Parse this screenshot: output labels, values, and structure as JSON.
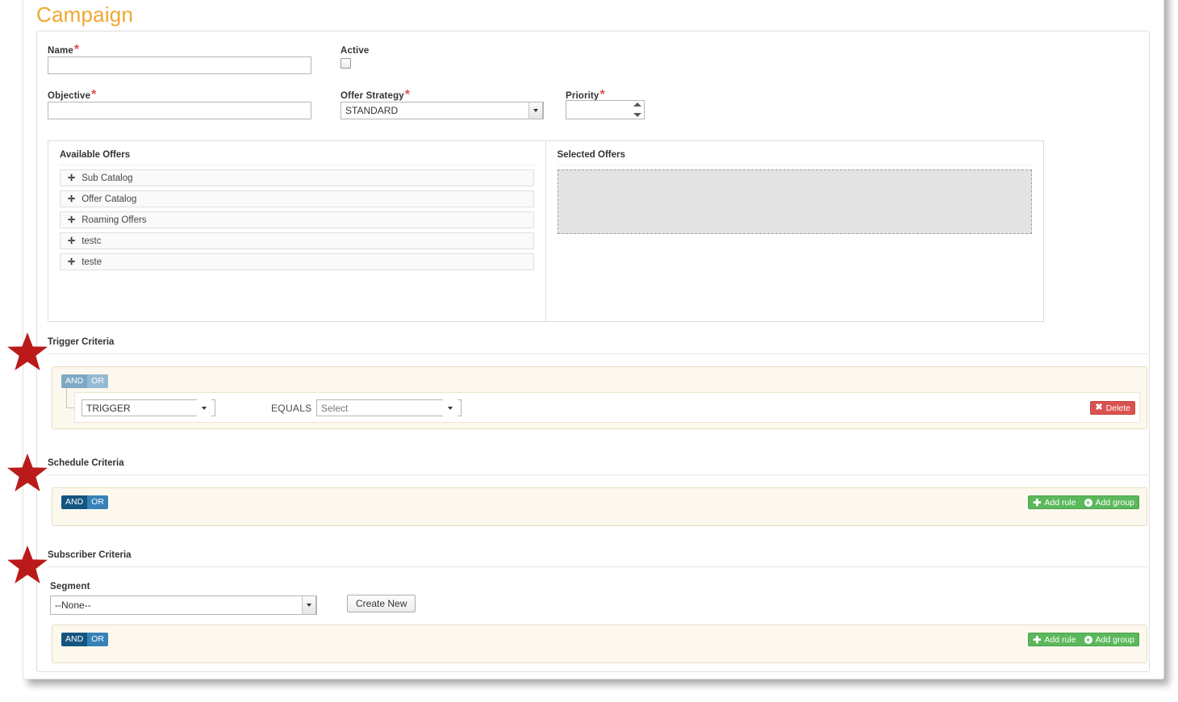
{
  "page": {
    "title": "Campaign"
  },
  "form": {
    "name": {
      "label": "Name",
      "required": "*",
      "value": "",
      "placeholder": ""
    },
    "active": {
      "label": "Active",
      "checked": false
    },
    "objective": {
      "label": "Objective",
      "required": "*",
      "value": "",
      "placeholder": ""
    },
    "offer_strategy": {
      "label": "Offer Strategy",
      "required": "*",
      "value": "STANDARD",
      "options": [
        "STANDARD"
      ]
    },
    "priority": {
      "label": "Priority",
      "required": "*",
      "value": ""
    }
  },
  "offers": {
    "available": {
      "title": "Available Offers",
      "items": [
        {
          "label": "Sub Catalog",
          "icon": "plus-icon"
        },
        {
          "label": "Offer Catalog",
          "icon": "plus-icon"
        },
        {
          "label": "Roaming Offers",
          "icon": "plus-icon"
        },
        {
          "label": "testc",
          "icon": "plus-icon"
        },
        {
          "label": "teste",
          "icon": "plus-icon"
        }
      ]
    },
    "selected": {
      "title": "Selected Offers",
      "items": [],
      "dropzone_text": ""
    }
  },
  "trigger_criteria": {
    "title": "Trigger Criteria",
    "andor": {
      "and": "AND",
      "or": "OR",
      "active": "AND"
    },
    "rule": {
      "field": "TRIGGER",
      "operator": "EQUALS",
      "value": "Select",
      "delete_label": "Delete",
      "delete_icon": "close-x-icon"
    }
  },
  "schedule_criteria": {
    "title": "Schedule Criteria",
    "andor": {
      "and": "AND",
      "or": "OR",
      "active": "AND"
    },
    "add_rule_label": "Add rule",
    "add_group_label": "Add group",
    "add_rule_icon": "plus-icon",
    "add_group_icon": "plus-circle-icon"
  },
  "subscriber_criteria": {
    "title": "Subscriber Criteria",
    "segment": {
      "label": "Segment",
      "value": "--None--",
      "options": [
        "--None--"
      ]
    },
    "create_new_label": "Create New",
    "andor": {
      "and": "AND",
      "or": "OR",
      "active": "AND"
    },
    "add_rule_label": "Add rule",
    "add_group_label": "Add group",
    "add_rule_icon": "plus-icon",
    "add_group_icon": "plus-circle-icon"
  },
  "annotations": {
    "markers": [
      {
        "name": "star-marker-trigger",
        "color": "#bb1a1a"
      },
      {
        "name": "star-marker-schedule",
        "color": "#bb1a1a"
      },
      {
        "name": "star-marker-subscriber",
        "color": "#bb1a1a"
      }
    ]
  },
  "colors": {
    "title": "#f0a830",
    "required": "#d9534f",
    "panel_bg": "#fdf8ee",
    "andor_active": "#15557f",
    "andor_inactive": "#3681b8",
    "delete": "#d9534f",
    "add": "#5cb85c",
    "star": "#bb1a1a"
  }
}
